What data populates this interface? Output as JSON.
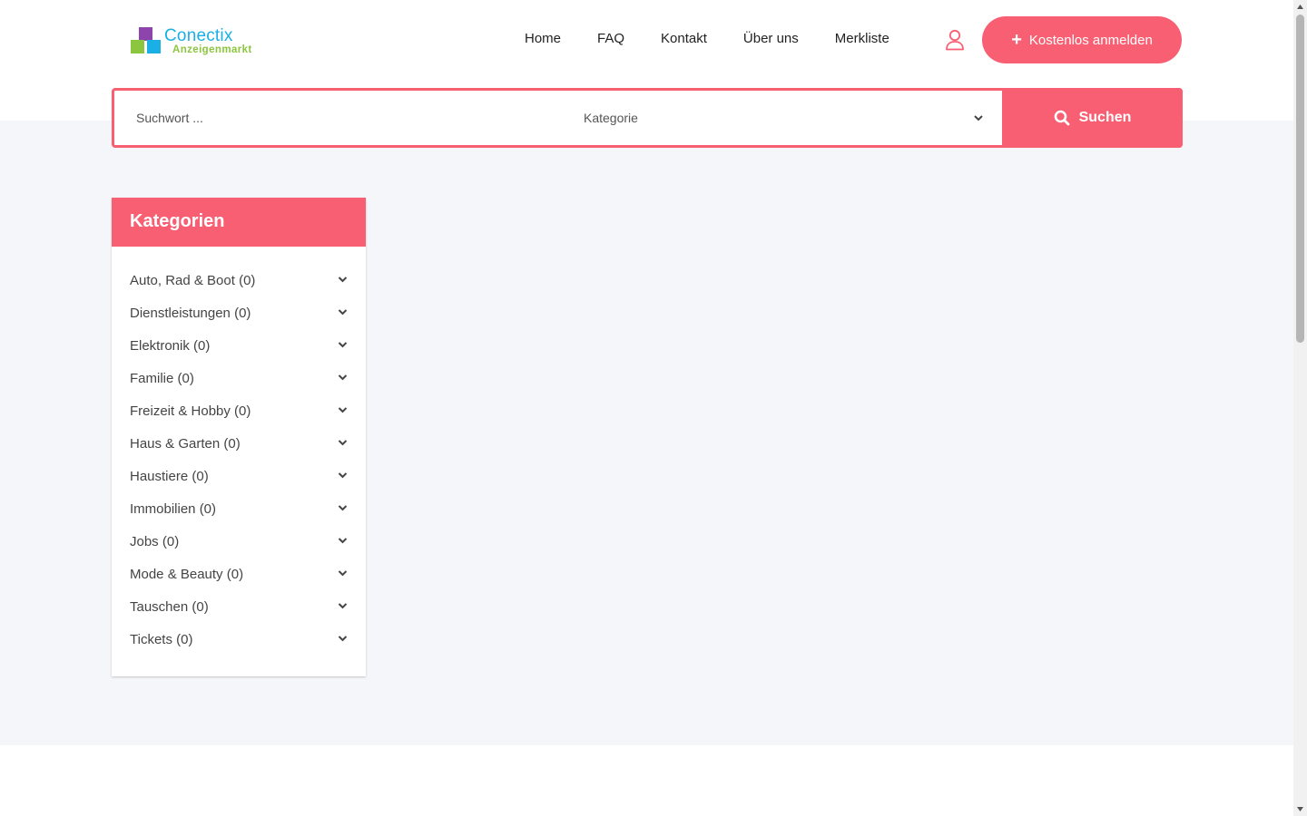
{
  "logo": {
    "brand": "Conectix",
    "sub": "Anzeigenmarkt"
  },
  "nav": {
    "items": [
      "Home",
      "FAQ",
      "Kontakt",
      "Über uns",
      "Merkliste"
    ]
  },
  "header": {
    "signup_label": "Kostenlos anmelden"
  },
  "search": {
    "placeholder": "Suchwort ...",
    "category_label": "Kategorie",
    "button_label": "Suchen"
  },
  "sidebar": {
    "title": "Kategorien",
    "items": [
      {
        "label": "Auto, Rad & Boot (0)"
      },
      {
        "label": "Dienstleistungen (0)"
      },
      {
        "label": "Elektronik (0)"
      },
      {
        "label": "Familie (0)"
      },
      {
        "label": "Freizeit & Hobby (0)"
      },
      {
        "label": "Haus & Garten (0)"
      },
      {
        "label": "Haustiere (0)"
      },
      {
        "label": "Immobilien (0)"
      },
      {
        "label": "Jobs (0)"
      },
      {
        "label": "Mode & Beauty (0)"
      },
      {
        "label": "Tauschen (0)"
      },
      {
        "label": "Tickets (0)"
      }
    ]
  },
  "colors": {
    "accent": "#f95f72",
    "background": "#f5f6fa",
    "logo_blue": "#1ab0e6",
    "logo_green": "#8cc63f",
    "logo_purple": "#8e44ad"
  }
}
